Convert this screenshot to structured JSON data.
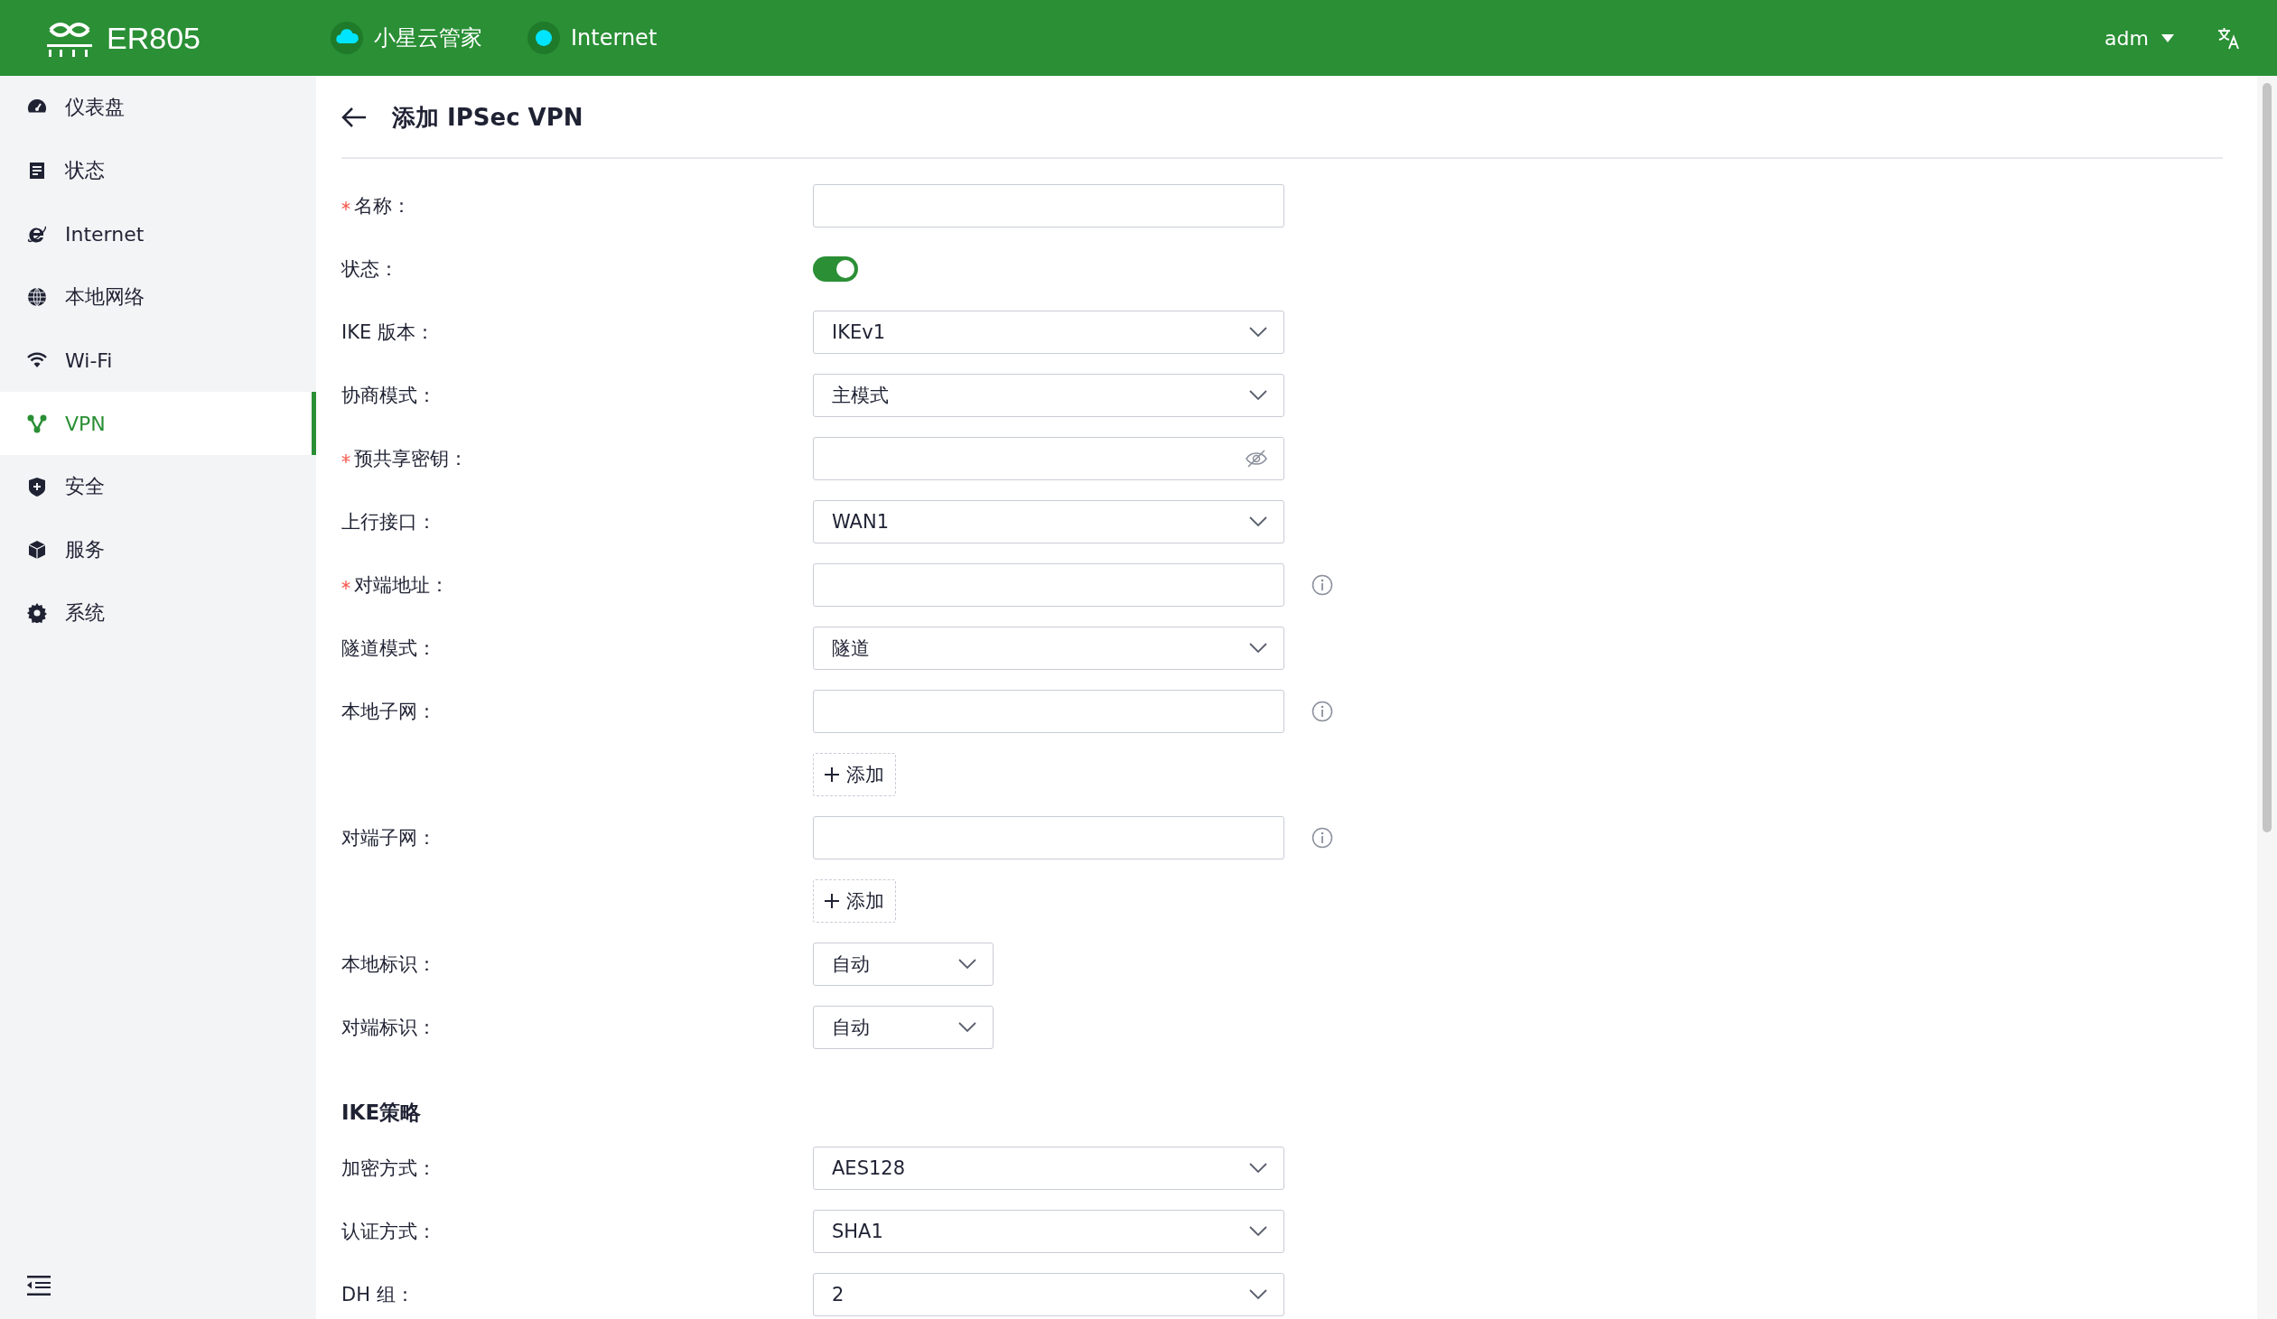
{
  "header": {
    "product": "ER805",
    "status": [
      {
        "kind": "cloud",
        "label": "小星云管家"
      },
      {
        "kind": "dot",
        "label": "Internet"
      }
    ],
    "user": "adm"
  },
  "sidebar": {
    "items": [
      {
        "kind": "dashboard",
        "label": "仪表盘",
        "selected": false
      },
      {
        "kind": "status",
        "label": "状态",
        "selected": false
      },
      {
        "kind": "internet",
        "label": "Internet",
        "selected": false
      },
      {
        "kind": "globe",
        "label": "本地网络",
        "selected": false
      },
      {
        "kind": "wifi",
        "label": "Wi-Fi",
        "selected": false
      },
      {
        "kind": "vpn",
        "label": "VPN",
        "selected": true
      },
      {
        "kind": "shield",
        "label": "安全",
        "selected": false
      },
      {
        "kind": "box",
        "label": "服务",
        "selected": false
      },
      {
        "kind": "gear",
        "label": "系统",
        "selected": false
      }
    ]
  },
  "page": {
    "title": "添加 IPSec VPN"
  },
  "form": [
    {
      "kind": "input",
      "label": "名称：",
      "required": true
    },
    {
      "kind": "switch",
      "label": "状态：",
      "on": true
    },
    {
      "kind": "select",
      "label": "IKE 版本：",
      "value": "IKEv1"
    },
    {
      "kind": "select",
      "label": "协商模式：",
      "value": "主模式"
    },
    {
      "kind": "password",
      "label": "预共享密钥：",
      "required": true
    },
    {
      "kind": "select",
      "label": "上行接口：",
      "value": "WAN1"
    },
    {
      "kind": "input",
      "label": "对端地址：",
      "required": true,
      "info": true
    },
    {
      "kind": "select",
      "label": "隧道模式：",
      "value": "隧道"
    },
    {
      "kind": "input",
      "label": "本地子网：",
      "info": true
    },
    {
      "kind": "add",
      "label": "添加"
    },
    {
      "kind": "input",
      "label": "对端子网：",
      "info": true
    },
    {
      "kind": "add",
      "label": "添加"
    },
    {
      "kind": "select",
      "label": "本地标识：",
      "value": "自动",
      "compact": true
    },
    {
      "kind": "select",
      "label": "对端标识：",
      "value": "自动",
      "compact": true
    },
    {
      "kind": "heading",
      "label": "IKE策略"
    },
    {
      "kind": "select",
      "label": "加密方式：",
      "value": "AES128"
    },
    {
      "kind": "select",
      "label": "认证方式：",
      "value": "SHA1"
    },
    {
      "kind": "select",
      "label": "DH 组：",
      "value": "2"
    }
  ]
}
